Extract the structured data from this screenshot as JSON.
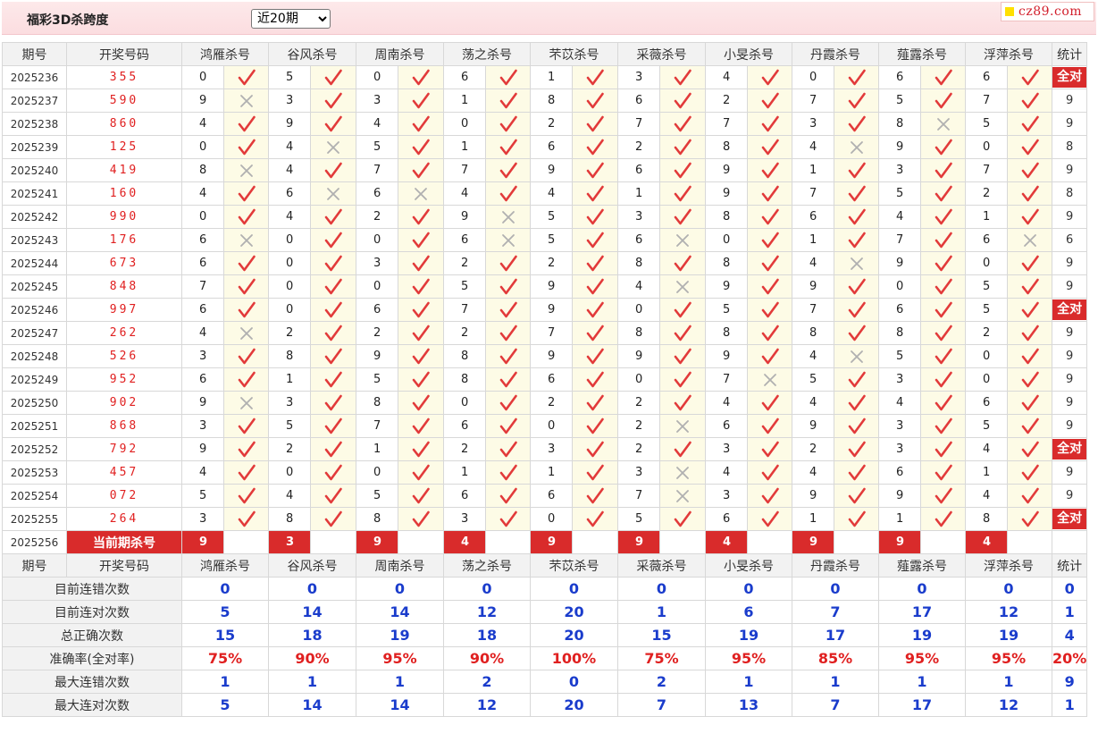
{
  "page_title": "福彩3D杀跨度",
  "period_select": {
    "value": "近20期"
  },
  "logo": {
    "text": "cz89.com"
  },
  "headers": [
    "期号",
    "开奖号码",
    "鸿雁杀号",
    "谷风杀号",
    "周南杀号",
    "荡之杀号",
    "芣苡杀号",
    "采薇杀号",
    "小旻杀号",
    "丹霞杀号",
    "薤露杀号",
    "浮萍杀号",
    "统计"
  ],
  "rows": [
    {
      "issue": "2025236",
      "draw": "355",
      "kills": [
        [
          "0",
          "r"
        ],
        [
          "5",
          "r"
        ],
        [
          "0",
          "r"
        ],
        [
          "6",
          "r"
        ],
        [
          "1",
          "r"
        ],
        [
          "3",
          "r"
        ],
        [
          "4",
          "r"
        ],
        [
          "0",
          "r"
        ],
        [
          "6",
          "r"
        ],
        [
          "6",
          "r"
        ]
      ],
      "stat": "全对"
    },
    {
      "issue": "2025237",
      "draw": "590",
      "kills": [
        [
          "9",
          "w"
        ],
        [
          "3",
          "r"
        ],
        [
          "3",
          "r"
        ],
        [
          "1",
          "r"
        ],
        [
          "8",
          "r"
        ],
        [
          "6",
          "r"
        ],
        [
          "2",
          "r"
        ],
        [
          "7",
          "r"
        ],
        [
          "5",
          "r"
        ],
        [
          "7",
          "r"
        ]
      ],
      "stat": "9"
    },
    {
      "issue": "2025238",
      "draw": "860",
      "kills": [
        [
          "4",
          "r"
        ],
        [
          "9",
          "r"
        ],
        [
          "4",
          "r"
        ],
        [
          "0",
          "r"
        ],
        [
          "2",
          "r"
        ],
        [
          "7",
          "r"
        ],
        [
          "7",
          "r"
        ],
        [
          "3",
          "r"
        ],
        [
          "8",
          "w"
        ],
        [
          "5",
          "r"
        ]
      ],
      "stat": "9"
    },
    {
      "issue": "2025239",
      "draw": "125",
      "kills": [
        [
          "0",
          "r"
        ],
        [
          "4",
          "w"
        ],
        [
          "5",
          "r"
        ],
        [
          "1",
          "r"
        ],
        [
          "6",
          "r"
        ],
        [
          "2",
          "r"
        ],
        [
          "8",
          "r"
        ],
        [
          "4",
          "w"
        ],
        [
          "9",
          "r"
        ],
        [
          "0",
          "r"
        ]
      ],
      "stat": "8"
    },
    {
      "issue": "2025240",
      "draw": "419",
      "kills": [
        [
          "8",
          "w"
        ],
        [
          "4",
          "r"
        ],
        [
          "7",
          "r"
        ],
        [
          "7",
          "r"
        ],
        [
          "9",
          "r"
        ],
        [
          "6",
          "r"
        ],
        [
          "9",
          "r"
        ],
        [
          "1",
          "r"
        ],
        [
          "3",
          "r"
        ],
        [
          "7",
          "r"
        ]
      ],
      "stat": "9"
    },
    {
      "issue": "2025241",
      "draw": "160",
      "kills": [
        [
          "4",
          "r"
        ],
        [
          "6",
          "w"
        ],
        [
          "6",
          "w"
        ],
        [
          "4",
          "r"
        ],
        [
          "4",
          "r"
        ],
        [
          "1",
          "r"
        ],
        [
          "9",
          "r"
        ],
        [
          "7",
          "r"
        ],
        [
          "5",
          "r"
        ],
        [
          "2",
          "r"
        ]
      ],
      "stat": "8"
    },
    {
      "issue": "2025242",
      "draw": "990",
      "kills": [
        [
          "0",
          "r"
        ],
        [
          "4",
          "r"
        ],
        [
          "2",
          "r"
        ],
        [
          "9",
          "w"
        ],
        [
          "5",
          "r"
        ],
        [
          "3",
          "r"
        ],
        [
          "8",
          "r"
        ],
        [
          "6",
          "r"
        ],
        [
          "4",
          "r"
        ],
        [
          "1",
          "r"
        ]
      ],
      "stat": "9"
    },
    {
      "issue": "2025243",
      "draw": "176",
      "kills": [
        [
          "6",
          "w"
        ],
        [
          "0",
          "r"
        ],
        [
          "0",
          "r"
        ],
        [
          "6",
          "w"
        ],
        [
          "5",
          "r"
        ],
        [
          "6",
          "w"
        ],
        [
          "0",
          "r"
        ],
        [
          "1",
          "r"
        ],
        [
          "7",
          "r"
        ],
        [
          "6",
          "w"
        ]
      ],
      "stat": "6"
    },
    {
      "issue": "2025244",
      "draw": "673",
      "kills": [
        [
          "6",
          "r"
        ],
        [
          "0",
          "r"
        ],
        [
          "3",
          "r"
        ],
        [
          "2",
          "r"
        ],
        [
          "2",
          "r"
        ],
        [
          "8",
          "r"
        ],
        [
          "8",
          "r"
        ],
        [
          "4",
          "w"
        ],
        [
          "9",
          "r"
        ],
        [
          "0",
          "r"
        ]
      ],
      "stat": "9"
    },
    {
      "issue": "2025245",
      "draw": "848",
      "kills": [
        [
          "7",
          "r"
        ],
        [
          "0",
          "r"
        ],
        [
          "0",
          "r"
        ],
        [
          "5",
          "r"
        ],
        [
          "9",
          "r"
        ],
        [
          "4",
          "w"
        ],
        [
          "9",
          "r"
        ],
        [
          "9",
          "r"
        ],
        [
          "0",
          "r"
        ],
        [
          "5",
          "r"
        ]
      ],
      "stat": "9"
    },
    {
      "issue": "2025246",
      "draw": "997",
      "kills": [
        [
          "6",
          "r"
        ],
        [
          "0",
          "r"
        ],
        [
          "6",
          "r"
        ],
        [
          "7",
          "r"
        ],
        [
          "9",
          "r"
        ],
        [
          "0",
          "r"
        ],
        [
          "5",
          "r"
        ],
        [
          "7",
          "r"
        ],
        [
          "6",
          "r"
        ],
        [
          "5",
          "r"
        ]
      ],
      "stat": "全对"
    },
    {
      "issue": "2025247",
      "draw": "262",
      "kills": [
        [
          "4",
          "w"
        ],
        [
          "2",
          "r"
        ],
        [
          "2",
          "r"
        ],
        [
          "2",
          "r"
        ],
        [
          "7",
          "r"
        ],
        [
          "8",
          "r"
        ],
        [
          "8",
          "r"
        ],
        [
          "8",
          "r"
        ],
        [
          "8",
          "r"
        ],
        [
          "2",
          "r"
        ]
      ],
      "stat": "9"
    },
    {
      "issue": "2025248",
      "draw": "526",
      "kills": [
        [
          "3",
          "r"
        ],
        [
          "8",
          "r"
        ],
        [
          "9",
          "r"
        ],
        [
          "8",
          "r"
        ],
        [
          "9",
          "r"
        ],
        [
          "9",
          "r"
        ],
        [
          "9",
          "r"
        ],
        [
          "4",
          "w"
        ],
        [
          "5",
          "r"
        ],
        [
          "0",
          "r"
        ]
      ],
      "stat": "9"
    },
    {
      "issue": "2025249",
      "draw": "952",
      "kills": [
        [
          "6",
          "r"
        ],
        [
          "1",
          "r"
        ],
        [
          "5",
          "r"
        ],
        [
          "8",
          "r"
        ],
        [
          "6",
          "r"
        ],
        [
          "0",
          "r"
        ],
        [
          "7",
          "w"
        ],
        [
          "5",
          "r"
        ],
        [
          "3",
          "r"
        ],
        [
          "0",
          "r"
        ]
      ],
      "stat": "9"
    },
    {
      "issue": "2025250",
      "draw": "902",
      "kills": [
        [
          "9",
          "w"
        ],
        [
          "3",
          "r"
        ],
        [
          "8",
          "r"
        ],
        [
          "0",
          "r"
        ],
        [
          "2",
          "r"
        ],
        [
          "2",
          "r"
        ],
        [
          "4",
          "r"
        ],
        [
          "4",
          "r"
        ],
        [
          "4",
          "r"
        ],
        [
          "6",
          "r"
        ]
      ],
      "stat": "9"
    },
    {
      "issue": "2025251",
      "draw": "868",
      "kills": [
        [
          "3",
          "r"
        ],
        [
          "5",
          "r"
        ],
        [
          "7",
          "r"
        ],
        [
          "6",
          "r"
        ],
        [
          "0",
          "r"
        ],
        [
          "2",
          "w"
        ],
        [
          "6",
          "r"
        ],
        [
          "9",
          "r"
        ],
        [
          "3",
          "r"
        ],
        [
          "5",
          "r"
        ]
      ],
      "stat": "9"
    },
    {
      "issue": "2025252",
      "draw": "792",
      "kills": [
        [
          "9",
          "r"
        ],
        [
          "2",
          "r"
        ],
        [
          "1",
          "r"
        ],
        [
          "2",
          "r"
        ],
        [
          "3",
          "r"
        ],
        [
          "2",
          "r"
        ],
        [
          "3",
          "r"
        ],
        [
          "2",
          "r"
        ],
        [
          "3",
          "r"
        ],
        [
          "4",
          "r"
        ]
      ],
      "stat": "全对"
    },
    {
      "issue": "2025253",
      "draw": "457",
      "kills": [
        [
          "4",
          "r"
        ],
        [
          "0",
          "r"
        ],
        [
          "0",
          "r"
        ],
        [
          "1",
          "r"
        ],
        [
          "1",
          "r"
        ],
        [
          "3",
          "w"
        ],
        [
          "4",
          "r"
        ],
        [
          "4",
          "r"
        ],
        [
          "6",
          "r"
        ],
        [
          "1",
          "r"
        ]
      ],
      "stat": "9"
    },
    {
      "issue": "2025254",
      "draw": "072",
      "kills": [
        [
          "5",
          "r"
        ],
        [
          "4",
          "r"
        ],
        [
          "5",
          "r"
        ],
        [
          "6",
          "r"
        ],
        [
          "6",
          "r"
        ],
        [
          "7",
          "w"
        ],
        [
          "3",
          "r"
        ],
        [
          "9",
          "r"
        ],
        [
          "9",
          "r"
        ],
        [
          "4",
          "r"
        ]
      ],
      "stat": "9"
    },
    {
      "issue": "2025255",
      "draw": "264",
      "kills": [
        [
          "3",
          "r"
        ],
        [
          "8",
          "r"
        ],
        [
          "8",
          "r"
        ],
        [
          "3",
          "r"
        ],
        [
          "0",
          "r"
        ],
        [
          "5",
          "r"
        ],
        [
          "6",
          "r"
        ],
        [
          "1",
          "r"
        ],
        [
          "1",
          "r"
        ],
        [
          "8",
          "r"
        ]
      ],
      "stat": "全对"
    }
  ],
  "current": {
    "issue": "2025256",
    "label": "当前期杀号",
    "kills": [
      "9",
      "3",
      "9",
      "4",
      "9",
      "9",
      "4",
      "9",
      "9",
      "4"
    ]
  },
  "stats_headers": [
    "期号",
    "开奖号码",
    "鸿雁杀号",
    "谷风杀号",
    "周南杀号",
    "荡之杀号",
    "芣苡杀号",
    "采薇杀号",
    "小旻杀号",
    "丹霞杀号",
    "薤露杀号",
    "浮萍杀号",
    "统计"
  ],
  "stats": [
    {
      "label": "目前连错次数",
      "color": "blue",
      "values": [
        "0",
        "0",
        "0",
        "0",
        "0",
        "0",
        "0",
        "0",
        "0",
        "0",
        "0"
      ]
    },
    {
      "label": "目前连对次数",
      "color": "blue",
      "values": [
        "5",
        "14",
        "14",
        "12",
        "20",
        "1",
        "6",
        "7",
        "17",
        "12",
        "1"
      ]
    },
    {
      "label": "总正确次数",
      "color": "blue",
      "values": [
        "15",
        "18",
        "19",
        "18",
        "20",
        "15",
        "19",
        "17",
        "19",
        "19",
        "4"
      ]
    },
    {
      "label": "准确率(全对率)",
      "color": "red",
      "values": [
        "75%",
        "90%",
        "95%",
        "90%",
        "100%",
        "75%",
        "95%",
        "85%",
        "95%",
        "95%",
        "20%"
      ]
    },
    {
      "label": "最大连错次数",
      "color": "blue",
      "values": [
        "1",
        "1",
        "1",
        "2",
        "0",
        "2",
        "1",
        "1",
        "1",
        "1",
        "9"
      ]
    },
    {
      "label": "最大连对次数",
      "color": "blue",
      "values": [
        "5",
        "14",
        "14",
        "12",
        "20",
        "7",
        "13",
        "7",
        "17",
        "12",
        "1"
      ]
    }
  ]
}
